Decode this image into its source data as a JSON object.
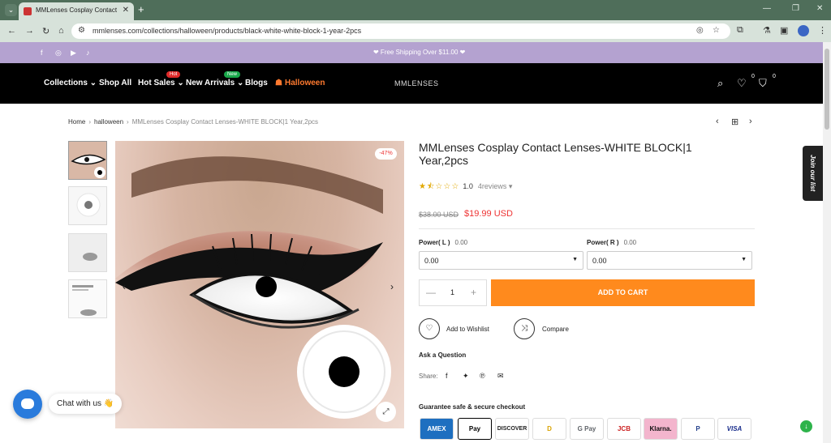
{
  "browser": {
    "tab_title": "MMLenses Cosplay Contact Len",
    "tab_close": "✕",
    "new_tab": "+",
    "url": "mmlenses.com/collections/halloween/products/black-white-white-block-1-year-2pcs",
    "win_minimize": "—",
    "win_restore": "❐",
    "win_close": "✕"
  },
  "announcement": {
    "text": "❤ Free Shipping Over $11.00 ❤"
  },
  "header": {
    "nav": [
      {
        "label": "Collections ⌄"
      },
      {
        "label": "Shop All"
      },
      {
        "label": "Hot Sales ⌄",
        "badge": "Hot"
      },
      {
        "label": "New Arrivals ⌄",
        "badge": "New"
      },
      {
        "label": "Blogs"
      },
      {
        "label": "Halloween"
      }
    ],
    "brand": "MMLENSES",
    "wishlist_count": "0",
    "cart_count": "0"
  },
  "breadcrumb": {
    "home": "Home",
    "category": "halloween",
    "current": "MMLenses Cosplay Contact Lenses-WHITE BLOCK|1 Year,2pcs",
    "sep": "›"
  },
  "product": {
    "title": "MMLenses Cosplay Contact Lenses-WHITE BLOCK|1 Year,2pcs",
    "discount": "-47%",
    "rating_stars": "★⯪☆☆☆",
    "rating_value": "1.0",
    "reviews": "4reviews ▾",
    "rating": 1.0,
    "old_price": "$38.00 USD",
    "new_price": "$19.99 USD",
    "power_l_label": "Power( L )",
    "power_l_value": "0.00",
    "power_r_label": "Power( R )",
    "power_r_value": "0.00",
    "select_l": "0.00",
    "select_r": "0.00",
    "qty": "1",
    "qty_minus": "—",
    "qty_plus": "+",
    "add_to_cart": "ADD TO CART",
    "wishlist": "Add to Wishlist",
    "compare": "Compare",
    "ask": "Ask a Question",
    "share": "Share:",
    "guarantee": "Guarantee safe & secure checkout",
    "payments": [
      "AMEX",
      "Pay",
      "DISCOVER",
      "D",
      "G Pay",
      "JCB",
      "Klarna.",
      "P",
      "VISA"
    ]
  },
  "side": {
    "join": "Join our list"
  },
  "chat": {
    "label": "Chat with us 👋"
  }
}
